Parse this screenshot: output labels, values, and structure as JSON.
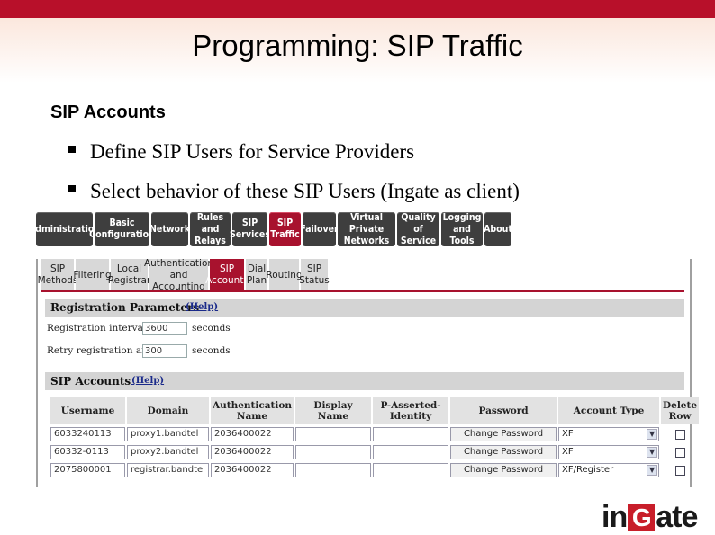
{
  "slide": {
    "title": "Programming: SIP Traffic",
    "subheading": "SIP Accounts",
    "bullets": [
      "Define SIP Users for Service Providers",
      "Select behavior of these SIP Users (Ingate as client)"
    ],
    "logo": {
      "pre": "in",
      "g": "G",
      "post": "ate"
    }
  },
  "colors": {
    "accent": "#a8122e",
    "nav": "#3e3e3e",
    "top_bar": "#b8102a"
  },
  "main_nav": [
    {
      "label": "Administration",
      "active": false
    },
    {
      "label": "Basic\nConfiguration",
      "active": false
    },
    {
      "label": "Network",
      "active": false
    },
    {
      "label": "Rules and\nRelays",
      "active": false
    },
    {
      "label": "SIP\nServices",
      "active": false
    },
    {
      "label": "SIP\nTraffic",
      "active": true
    },
    {
      "label": "Failover",
      "active": false
    },
    {
      "label": "Virtual Private\nNetworks",
      "active": false
    },
    {
      "label": "Quality of\nService",
      "active": false
    },
    {
      "label": "Logging\nand Tools",
      "active": false
    },
    {
      "label": "About",
      "active": false
    }
  ],
  "sub_nav": [
    {
      "label": "SIP\nMethods",
      "active": false
    },
    {
      "label": "Filtering",
      "active": false
    },
    {
      "label": "Local\nRegistrar",
      "active": false
    },
    {
      "label": "Authentication\nand Accounting",
      "active": false
    },
    {
      "label": "SIP\nAccounts",
      "active": true
    },
    {
      "label": "Dial\nPlan",
      "active": false
    },
    {
      "label": "Routing",
      "active": false
    },
    {
      "label": "SIP\nStatus",
      "active": false
    }
  ],
  "registration": {
    "title": "Registration Parameters",
    "help": "(Help)",
    "interval_label": "Registration interval:",
    "interval_value": "3600",
    "interval_unit": "seconds",
    "retry_label": "Retry registration after:",
    "retry_value": "300",
    "retry_unit": "seconds"
  },
  "accounts": {
    "title": "SIP Accounts",
    "help": "(Help)",
    "columns": [
      "Username",
      "Domain",
      "Authentication\nName",
      "Display Name",
      "P-Asserted-\nIdentity",
      "Password",
      "Account Type",
      "Delete\nRow"
    ],
    "rows": [
      {
        "username": "6033240113",
        "domain": "proxy1.bandtel",
        "auth_name": "2036400022",
        "display": "",
        "pai": "",
        "password": "Change Password",
        "type": "XF",
        "delete": false
      },
      {
        "username": "60332-0113",
        "domain": "proxy2.bandtel",
        "auth_name": "2036400022",
        "display": "",
        "pai": "",
        "password": "Change Password",
        "type": "XF",
        "delete": false
      },
      {
        "username": "2075800001",
        "domain": "registrar.bandtel",
        "auth_name": "2036400022",
        "display": "",
        "pai": "",
        "password": "Change Password",
        "type": "XF/Register",
        "delete": false
      }
    ]
  }
}
